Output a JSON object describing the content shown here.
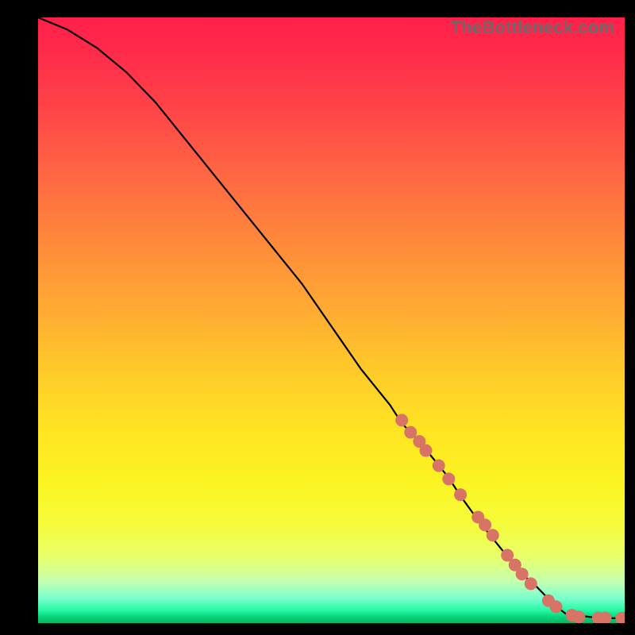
{
  "watermark": "TheBottleneck.com",
  "chart_data": {
    "type": "line",
    "title": "",
    "xlabel": "",
    "ylabel": "",
    "xlim": [
      0,
      100
    ],
    "ylim": [
      0,
      100
    ],
    "grid": false,
    "legend": false,
    "series": [
      {
        "name": "curve",
        "x": [
          0,
          5,
          10,
          15,
          20,
          25,
          30,
          35,
          40,
          45,
          50,
          55,
          60,
          62,
          65,
          70,
          72,
          75,
          80,
          82,
          85,
          88,
          90,
          95,
          98,
          100
        ],
        "y": [
          100,
          98,
          95,
          91,
          86,
          80,
          74,
          68,
          62,
          56,
          49,
          42,
          36,
          33,
          30,
          24,
          21,
          17,
          11,
          8.5,
          6,
          3,
          1.5,
          0.9,
          0.8,
          0.8
        ]
      }
    ],
    "marker_groups": [
      {
        "name": "cluster-1",
        "color": "#d77465",
        "radius": 8,
        "points": [
          {
            "x": 62,
            "y": 33.5
          },
          {
            "x": 63.5,
            "y": 31.5
          },
          {
            "x": 65,
            "y": 30
          },
          {
            "x": 66.1,
            "y": 28.5
          },
          {
            "x": 68.3,
            "y": 26
          },
          {
            "x": 70,
            "y": 23.8
          },
          {
            "x": 72,
            "y": 21.2
          },
          {
            "x": 75,
            "y": 17.5
          },
          {
            "x": 76.2,
            "y": 16.2
          },
          {
            "x": 77.5,
            "y": 14.5
          },
          {
            "x": 80,
            "y": 11.2
          },
          {
            "x": 81.3,
            "y": 9.6
          },
          {
            "x": 82.5,
            "y": 8.1
          },
          {
            "x": 84,
            "y": 6.5
          },
          {
            "x": 87,
            "y": 3.7
          },
          {
            "x": 88.3,
            "y": 2.7
          }
        ]
      },
      {
        "name": "cluster-2",
        "color": "#d77465",
        "radius": 8,
        "points": [
          {
            "x": 91,
            "y": 1.3
          },
          {
            "x": 92.2,
            "y": 1.0
          },
          {
            "x": 95.5,
            "y": 0.85
          },
          {
            "x": 96.7,
            "y": 0.85
          },
          {
            "x": 99.5,
            "y": 0.8
          },
          {
            "x": 100,
            "y": 0.8
          }
        ]
      }
    ]
  }
}
